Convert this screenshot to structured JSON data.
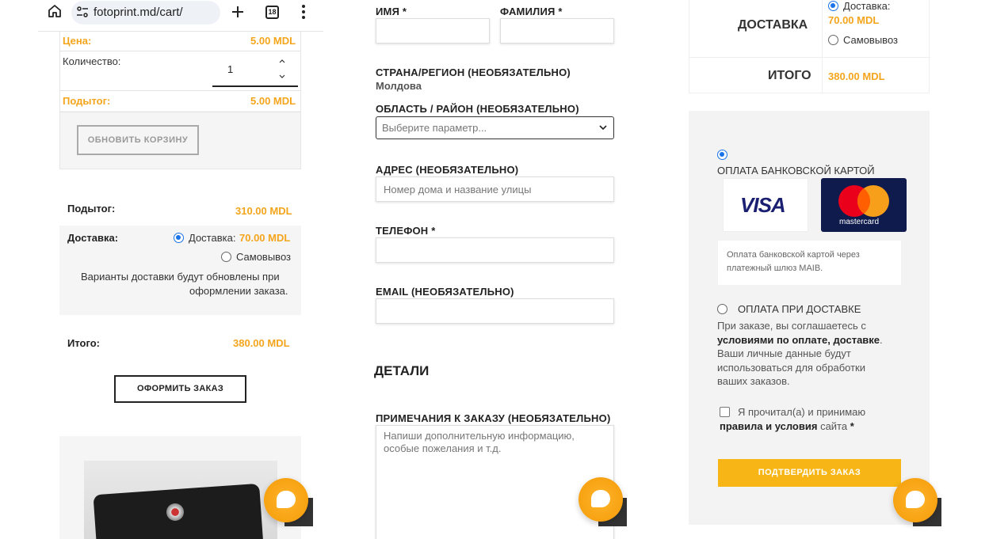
{
  "browser": {
    "url": "fotoprint.md/cart/",
    "tab_count": "18"
  },
  "cart_item": {
    "price_label": "Цена:",
    "price_value": "5.00 MDL",
    "quantity_label": "Количество:",
    "quantity_value": "1",
    "subtotal_label": "Подытог:",
    "subtotal_value": "5.00 MDL",
    "update_button": "ОБНОВИТЬ КОРЗИНУ"
  },
  "cart_totals": {
    "subtotal_label": "Подытог:",
    "subtotal_value": "310.00 MDL",
    "shipping_label": "Доставка:",
    "shipping_option_delivery": "Доставка:",
    "shipping_option_delivery_price": "70.00 MDL",
    "shipping_option_pickup": "Самовывоз",
    "shipping_note_line1": "Варианты доставки будут обновлены при",
    "shipping_note_line2": "оформлении заказа.",
    "total_label": "Итого:",
    "total_value": "380.00 MDL",
    "checkout_button": "ОФОРМИТЬ ЗАКАЗ"
  },
  "checkout_form": {
    "first_name_label": "ИМЯ *",
    "last_name_label": "ФАМИЛИЯ *",
    "country_label": "СТРАНА/РЕГИОН (НЕОБЯЗАТЕЛЬНО)",
    "country_value": "Молдова",
    "region_label": "ОБЛАСТЬ / РАЙОН (НЕОБЯЗАТЕЛЬНО)",
    "region_placeholder": "Выберите параметр...",
    "address_label": "АДРЕС (НЕОБЯЗАТЕЛЬНО)",
    "address_placeholder": "Номер дома и название улицы",
    "phone_label": "ТЕЛЕФОН *",
    "email_label": "EMAIL (НЕОБЯЗАТЕЛЬНО)",
    "details_heading": "ДЕТАЛИ",
    "notes_label": "ПРИМЕЧАНИЯ К ЗАКАЗУ (НЕОБЯЗАТЕЛЬНО)",
    "notes_placeholder_line1": "Напиши дополнительную информацию,",
    "notes_placeholder_line2": "особые пожелания и т.д."
  },
  "order_review": {
    "delivery_label": "ДОСТАВКА",
    "delivery_option": "Доставка:",
    "delivery_price": "70.00 MDL",
    "pickup_option": "Самовывоз",
    "total_label": "ИТОГО",
    "total_value": "380.00 MDL"
  },
  "payment": {
    "card_option": "ОПЛАТА БАНКОВСКОЙ КАРТОЙ",
    "visa_text": "VISA",
    "mastercard_text": "mastercard",
    "card_info_line1": "Оплата банковской картой через",
    "card_info_line2": "платежный шлюз MAIB.",
    "cod_option": "ОПЛАТА ПРИ ДОСТАВКЕ",
    "privacy_line1": "При заказе, вы соглашаетесь с",
    "privacy_bold": "условиями по оплате, доставке",
    "privacy_period": ".",
    "privacy_line3": "Ваши личные данные будут",
    "privacy_line4": "использоваться для обработки",
    "privacy_line5": "ваших заказов.",
    "terms_prefix": "Я прочитал(а) и принимаю",
    "terms_bold": "правила и условия",
    "terms_suffix": " сайта ",
    "terms_required": "*",
    "confirm_button": "ПОДТВЕРДИТЬ ЗАКАЗ"
  },
  "colors": {
    "accent": "#f4a51c",
    "confirm_button": "#f7b615",
    "radio_selected": "#1a73e8"
  }
}
